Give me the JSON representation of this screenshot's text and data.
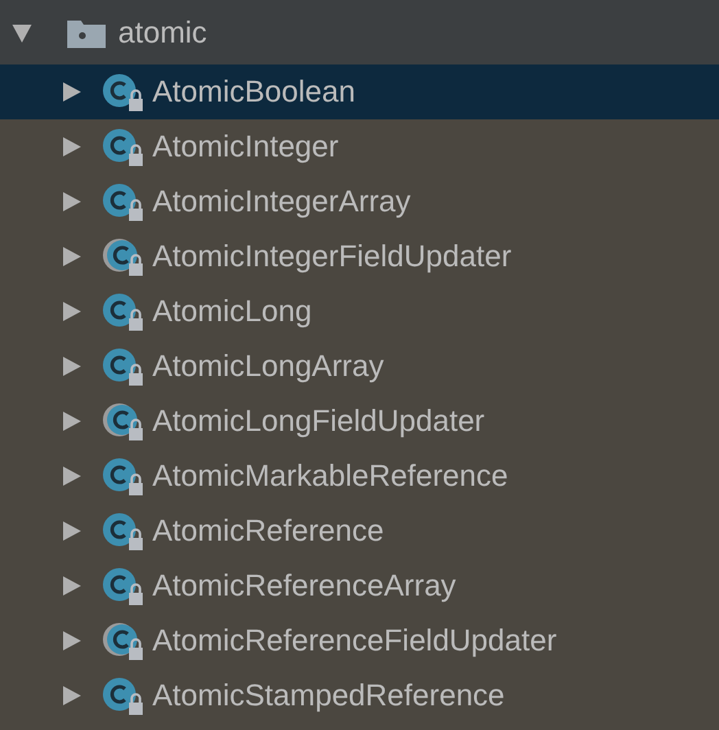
{
  "folder": {
    "name": "atomic",
    "expanded": true
  },
  "items": [
    {
      "name": "AtomicBoolean",
      "kind": "class",
      "selected": true
    },
    {
      "name": "AtomicInteger",
      "kind": "class",
      "selected": false
    },
    {
      "name": "AtomicIntegerArray",
      "kind": "class",
      "selected": false
    },
    {
      "name": "AtomicIntegerFieldUpdater",
      "kind": "abstract",
      "selected": false
    },
    {
      "name": "AtomicLong",
      "kind": "class",
      "selected": false
    },
    {
      "name": "AtomicLongArray",
      "kind": "class",
      "selected": false
    },
    {
      "name": "AtomicLongFieldUpdater",
      "kind": "abstract",
      "selected": false
    },
    {
      "name": "AtomicMarkableReference",
      "kind": "class",
      "selected": false
    },
    {
      "name": "AtomicReference",
      "kind": "class",
      "selected": false
    },
    {
      "name": "AtomicReferenceArray",
      "kind": "class",
      "selected": false
    },
    {
      "name": "AtomicReferenceFieldUpdater",
      "kind": "abstract",
      "selected": false
    },
    {
      "name": "AtomicStampedReference",
      "kind": "class",
      "selected": false
    }
  ]
}
